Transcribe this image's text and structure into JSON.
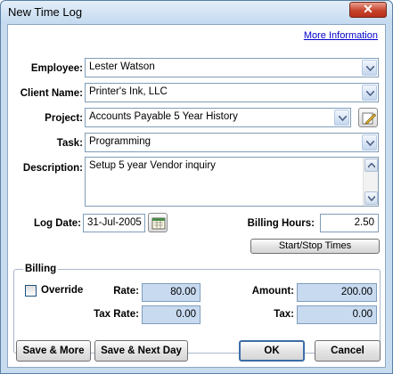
{
  "window": {
    "title": "New Time Log",
    "close_label": "✕"
  },
  "link_more_info": "More Information",
  "employee": {
    "label": "Employee:",
    "value": "Lester Watson"
  },
  "client": {
    "label": "Client Name:",
    "value": "Printer's Ink, LLC"
  },
  "project": {
    "label": "Project:",
    "value": "Accounts Payable 5 Year History"
  },
  "task": {
    "label": "Task:",
    "value": "Programming"
  },
  "description": {
    "label": "Description:",
    "value": "Setup 5 year Vendor inquiry"
  },
  "log_date": {
    "label": "Log Date:",
    "value": "31-Jul-2005"
  },
  "billing_hours": {
    "label": "Billing Hours:",
    "value": "2.50"
  },
  "start_stop_button": "Start/Stop Times",
  "billing": {
    "title": "Billing",
    "override_label": "Override",
    "rate_label": "Rate:",
    "rate_value": "80.00",
    "tax_rate_label": "Tax Rate:",
    "tax_rate_value": "0.00",
    "amount_label": "Amount:",
    "amount_value": "200.00",
    "tax_label": "Tax:",
    "tax_value": "0.00"
  },
  "buttons": {
    "save_more": "Save & More",
    "save_next_day": "Save & Next Day",
    "ok": "OK",
    "cancel": "Cancel"
  },
  "icons": [
    "dropdown-arrow-icon",
    "edit-pencil-icon",
    "calendar-icon",
    "scroll-up-icon",
    "scroll-down-icon",
    "close-icon"
  ]
}
